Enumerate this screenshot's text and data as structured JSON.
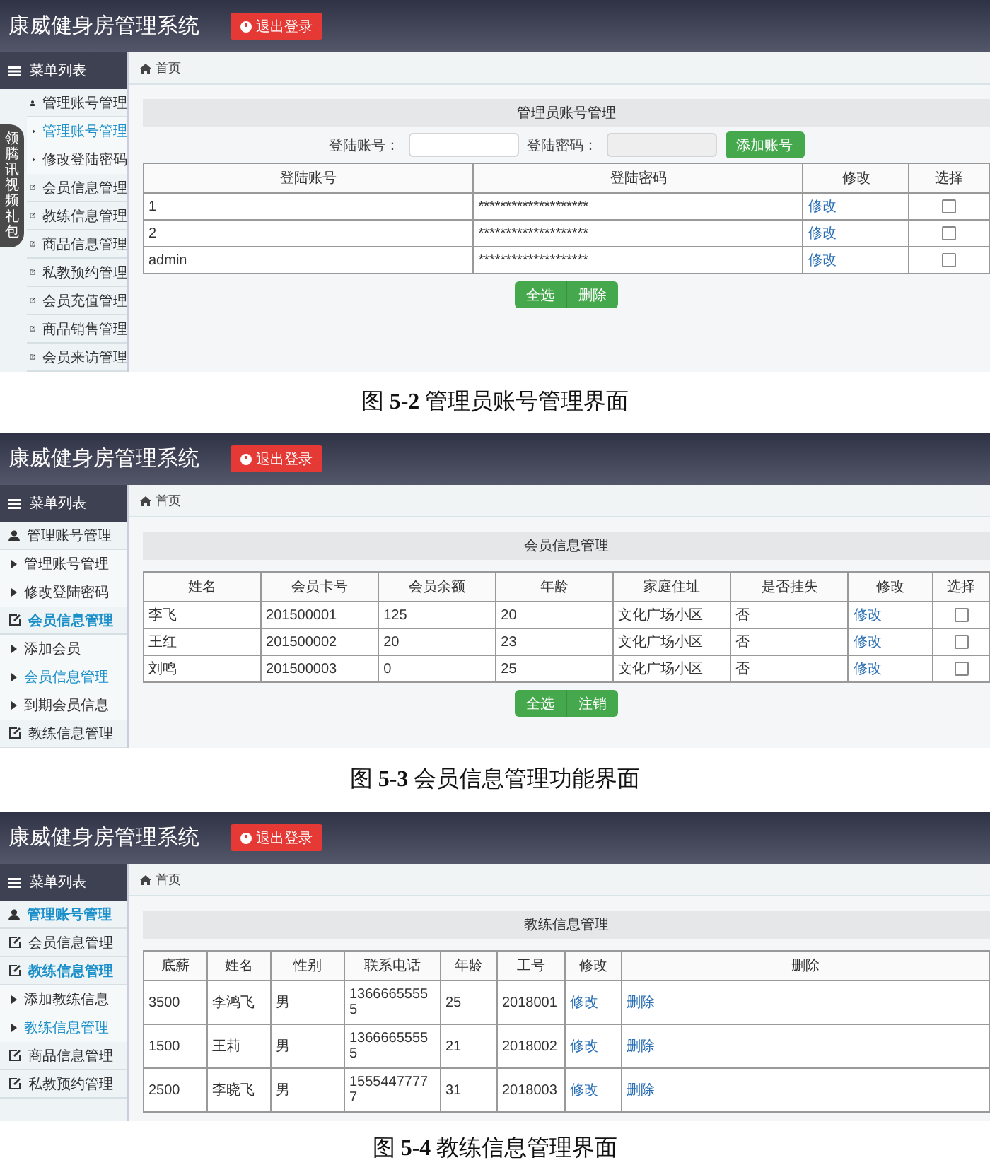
{
  "figures": [
    {
      "app_title": "康威健身房管理系统",
      "logout_label": "退出登录",
      "menu_header": "菜单列表",
      "breadcrumb": "首页",
      "sidebar": [
        {
          "label": "管理账号管理",
          "kind": "user",
          "selected": false
        },
        {
          "label": "管理账号管理",
          "kind": "sub",
          "selected": true
        },
        {
          "label": "修改登陆密码",
          "kind": "sub",
          "selected": false
        },
        {
          "label": "会员信息管理",
          "kind": "edit",
          "selected": false
        },
        {
          "label": "教练信息管理",
          "kind": "edit",
          "selected": false
        },
        {
          "label": "商品信息管理",
          "kind": "edit",
          "selected": false
        },
        {
          "label": "私教预约管理",
          "kind": "edit",
          "selected": false
        },
        {
          "label": "会员充值管理",
          "kind": "edit",
          "selected": false
        },
        {
          "label": "商品销售管理",
          "kind": "edit",
          "selected": false
        },
        {
          "label": "会员来访管理",
          "kind": "edit",
          "selected": false
        }
      ],
      "promo_tab": "领腾讯视频礼包",
      "panel": {
        "title": "管理员账号管理",
        "form": {
          "fields": [
            {
              "label": "登陆账号："
            },
            {
              "label": "登陆密码："
            }
          ],
          "button": "添加账号"
        },
        "columns": [
          {
            "label": "登陆账号",
            "kind": "text"
          },
          {
            "label": "登陆密码",
            "kind": "text"
          },
          {
            "label": "修改",
            "kind": "link"
          },
          {
            "label": "选择",
            "kind": "check"
          }
        ],
        "rows": [
          {
            "cells": [
              "1",
              "********************",
              "修改"
            ],
            "checked": false
          },
          {
            "cells": [
              "2",
              "********************",
              "修改"
            ],
            "checked": false
          },
          {
            "cells": [
              "admin",
              "********************",
              "修改"
            ],
            "checked": false
          }
        ],
        "buttons": [
          "全选",
          "删除"
        ]
      },
      "caption": "图 **5-2** 管理员账号管理界面"
    },
    {
      "app_title": "康威健身房管理系统",
      "logout_label": "退出登录",
      "menu_header": "菜单列表",
      "breadcrumb": "首页",
      "sidebar": [
        {
          "label": "管理账号管理",
          "kind": "user",
          "selected": false
        },
        {
          "label": "管理账号管理",
          "kind": "sub",
          "selected": false
        },
        {
          "label": "修改登陆密码",
          "kind": "sub",
          "selected": false
        },
        {
          "label": "会员信息管理",
          "kind": "edit",
          "selected": true
        },
        {
          "label": "添加会员",
          "kind": "sub",
          "selected": false
        },
        {
          "label": "会员信息管理",
          "kind": "sub",
          "selected": true
        },
        {
          "label": "到期会员信息",
          "kind": "sub",
          "selected": false
        },
        {
          "label": "教练信息管理",
          "kind": "edit",
          "selected": false
        }
      ],
      "panel": {
        "title": "会员信息管理",
        "columns": [
          {
            "label": "姓名",
            "kind": "text"
          },
          {
            "label": "会员卡号",
            "kind": "text"
          },
          {
            "label": "会员余额",
            "kind": "text"
          },
          {
            "label": "年龄",
            "kind": "text"
          },
          {
            "label": "家庭住址",
            "kind": "text"
          },
          {
            "label": "是否挂失",
            "kind": "text"
          },
          {
            "label": "修改",
            "kind": "link"
          },
          {
            "label": "选择",
            "kind": "check"
          }
        ],
        "rows": [
          {
            "cells": [
              "李飞",
              "201500001",
              "125",
              "20",
              "文化广场小区",
              "否",
              "修改"
            ],
            "checked": false
          },
          {
            "cells": [
              "王红",
              "201500002",
              "20",
              "23",
              "文化广场小区",
              "否",
              "修改"
            ],
            "checked": false
          },
          {
            "cells": [
              "刘鸣",
              "201500003",
              "0",
              "25",
              "文化广场小区",
              "否",
              "修改"
            ],
            "checked": false
          }
        ],
        "buttons": [
          "全选",
          "注销"
        ]
      },
      "caption": "图 **5-3** 会员信息管理功能界面"
    },
    {
      "app_title": "康威健身房管理系统",
      "logout_label": "退出登录",
      "menu_header": "菜单列表",
      "breadcrumb": "首页",
      "sidebar": [
        {
          "label": "管理账号管理",
          "kind": "user",
          "selected": true
        },
        {
          "label": "会员信息管理",
          "kind": "edit",
          "selected": false
        },
        {
          "label": "教练信息管理",
          "kind": "edit",
          "selected": true
        },
        {
          "label": "添加教练信息",
          "kind": "sub",
          "selected": false
        },
        {
          "label": "教练信息管理",
          "kind": "sub",
          "selected": true
        },
        {
          "label": "商品信息管理",
          "kind": "edit",
          "selected": false
        },
        {
          "label": "私教预约管理",
          "kind": "edit",
          "selected": false
        }
      ],
      "panel": {
        "title": "教练信息管理",
        "columns": [
          {
            "label": "底薪",
            "kind": "text"
          },
          {
            "label": "姓名",
            "kind": "text"
          },
          {
            "label": "性别",
            "kind": "text"
          },
          {
            "label": "联系电话",
            "kind": "text"
          },
          {
            "label": "年龄",
            "kind": "text"
          },
          {
            "label": "工号",
            "kind": "text"
          },
          {
            "label": "修改",
            "kind": "link"
          },
          {
            "label": "删除",
            "kind": "link"
          }
        ],
        "rows": [
          {
            "cells": [
              "3500",
              "李鸿飞",
              "男",
              "13666655555",
              "25",
              "2018001",
              "修改",
              "删除"
            ]
          },
          {
            "cells": [
              "1500",
              "王莉",
              "男",
              "13666655555",
              "21",
              "2018002",
              "修改",
              "删除"
            ]
          },
          {
            "cells": [
              "2500",
              "李晓飞",
              "男",
              "15554477777",
              "31",
              "2018003",
              "修改",
              "删除"
            ]
          }
        ]
      },
      "caption": "图 **5-4** 教练信息管理界面"
    }
  ]
}
